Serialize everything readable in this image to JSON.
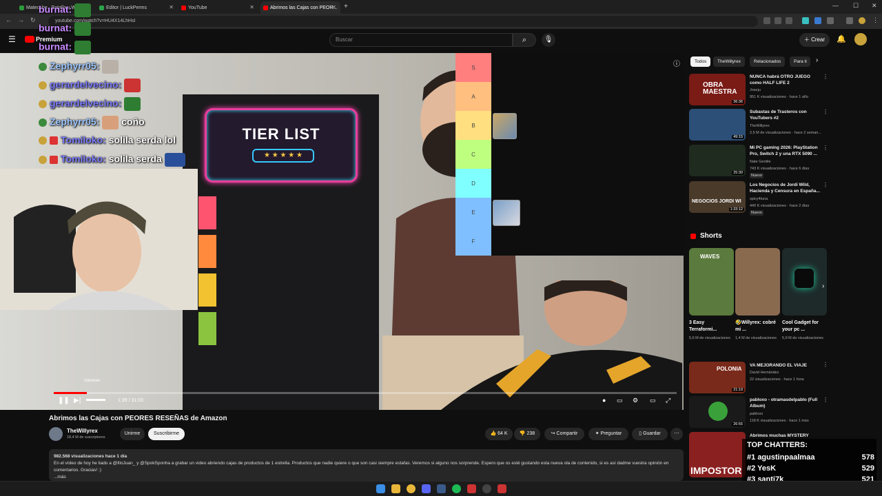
{
  "browser": {
    "tabs": [
      {
        "label": "Matecabe...Batalla y Wave...",
        "active": false
      },
      {
        "label": "Editor | LuckPerms",
        "active": false
      },
      {
        "label": "YouTube",
        "active": false
      },
      {
        "label": "Abrimos las Cajas con PEOR...",
        "active": true
      }
    ],
    "new_tab": "+",
    "url": "youtube.com/watch?v=HU4X14LhHsI"
  },
  "header": {
    "logo": "Premium",
    "search_placeholder": "Buscar",
    "create_label": "Crear"
  },
  "stream_chat": [
    {
      "user": "burnat:",
      "color": "#c98bff",
      "text": ""
    },
    {
      "user": "burnat:",
      "color": "#c98bff",
      "text": ""
    },
    {
      "user": "burnat:",
      "color": "#c98bff",
      "text": ""
    },
    {
      "user": "Zephyrr05:",
      "color": "#9ec7ff",
      "text": ""
    },
    {
      "user": "gerardelvecino:",
      "color": "#7c7cff",
      "text": ""
    },
    {
      "user": "gerardelvecino:",
      "color": "#7c7cff",
      "text": ""
    },
    {
      "user": "Zephyrr05:",
      "color": "#9ec7ff",
      "text": "coño"
    },
    {
      "user": "Tomiloko:",
      "color": "#7c7cff",
      "text": "solila serda lol"
    },
    {
      "user": "Tomiloko:",
      "color": "#7c7cff",
      "text": "solila serda"
    }
  ],
  "tier_list": {
    "board_title": "TIER LIST",
    "board_stars": "★ ★ ★ ★ ★",
    "tiers": [
      {
        "label": "S",
        "color": "#ff7f7f"
      },
      {
        "label": "A",
        "color": "#ffbf7f"
      },
      {
        "label": "B",
        "color": "#ffdf7f"
      },
      {
        "label": "C",
        "color": "#bfff7f"
      },
      {
        "label": "D",
        "color": "#7fffff"
      },
      {
        "label": "E",
        "color": "#7fbfff"
      },
      {
        "label": "F",
        "color": "#7fbfff"
      }
    ]
  },
  "player": {
    "volume_tooltip": "Volumen",
    "time": "1:39 / 31:03",
    "progress_fraction": 0.053
  },
  "video": {
    "title": "Abrimos las Cajas con PEORES RESEÑAS de Amazon",
    "channel": "TheWillyrex",
    "subscribers": "18,4 M de suscriptores",
    "join_label": "Unirme",
    "subscribe_label": "Suscribirme",
    "likes": "64 K",
    "dislikes": "238",
    "share_label": "Compartir",
    "ask_label": "Preguntar",
    "save_label": "Guardar",
    "desc_stats": "982.568 visualizaciones  hace 1 día",
    "desc_text": "En el vídeo de hoy he liado a @IlloJuan_ y @SpokSponha a grabar un video abriendo cajas de productos de 1 estrella. Productos que nadie quiere o que son casi siempre estafas. Veremos si alguno nos sorprende. Espero que os esté gustando esta nueva ola de contenido, si es así dadme vuestra opinión en comentarios. Gracias! :)",
    "desc_more": "...más"
  },
  "sidebar": {
    "chips": [
      "Todos",
      "TheWillyrex",
      "Relacionados",
      "Para ti"
    ],
    "videos": [
      {
        "title": "NUNCA habrá OTRO JUEGO como HALF LIFE 2",
        "channel": "Joseju",
        "meta": "951 K visualizaciones · hace 1 año",
        "duration": "36:36",
        "thumb": "#7a1b16",
        "overlay": "OBRA MAESTRA"
      },
      {
        "title": "Subastas de Trasteros con YouTubers #2",
        "channel": "TheWillyrex",
        "meta": "2,5 M de visualizaciones · hace 2 seman...",
        "duration": "49:15",
        "thumb": "#2c4f77",
        "overlay": ""
      },
      {
        "title": "Mi PC gaming 2026: PlayStation Pro, Switch 2 y una RTX 5090 ...",
        "channel": "Nate Gentile",
        "meta": "743 K visualizaciones · hace 6 días",
        "duration": "25:30",
        "thumb": "#1f2b1f",
        "overlay": "",
        "badge": "Nuevo"
      },
      {
        "title": "Los Negocios de Jordi Wild, Hacienda y Censura en España...",
        "channel": "spicy4tuna",
        "meta": "440 K visualizaciones · hace 2 días",
        "duration": "1:33:12",
        "thumb": "#4a3a2a",
        "overlay": "NEGOCIOS JORDI WI",
        "badge": "Nuevo"
      }
    ],
    "shorts_title": "Shorts",
    "shorts": [
      {
        "title": "3 Easy Terraformi...",
        "views": "5,6 M de visualizaciones",
        "label": "WAVES",
        "color": "#5b7a3d"
      },
      {
        "title": "🤣Willyrex: cobré mi ...",
        "views": "1,4 M de visualizaciones",
        "label": "",
        "color": "#8a6a4f"
      },
      {
        "title": "Cool Gadget for your pc ...",
        "views": "5,9 M de visualizaciones",
        "label": "",
        "color": "#1e2a2a"
      }
    ],
    "videos2": [
      {
        "title": "VA MEJORANDO EL VIAJE",
        "channel": "David Hernández",
        "meta": "22 visualizaciones · hace 1 hora",
        "duration": "21:19",
        "thumb": "#7a2a1a",
        "overlay": "POLONIA"
      },
      {
        "title": "pabloxo - otramasdelpablo (Full Album)",
        "channel": "pabloxo",
        "meta": "118 K visualizaciones · hace 1 mes",
        "duration": "26:55",
        "thumb": "#1a1a1a",
        "overlay": ""
      },
      {
        "title": "Abrimos muchas MYSTERY",
        "channel": "",
        "meta": "",
        "duration": "",
        "thumb": "#8a2020",
        "overlay": "IMPOSTOR"
      }
    ]
  },
  "top_chatters": {
    "title": "TOP CHATTERS:",
    "rows": [
      {
        "rank": "#1",
        "name": "agustinpaalmaa",
        "count": "578"
      },
      {
        "rank": "#2",
        "name": "YesK",
        "count": "529"
      },
      {
        "rank": "#3",
        "name": "santi7k",
        "count": "521"
      }
    ]
  }
}
